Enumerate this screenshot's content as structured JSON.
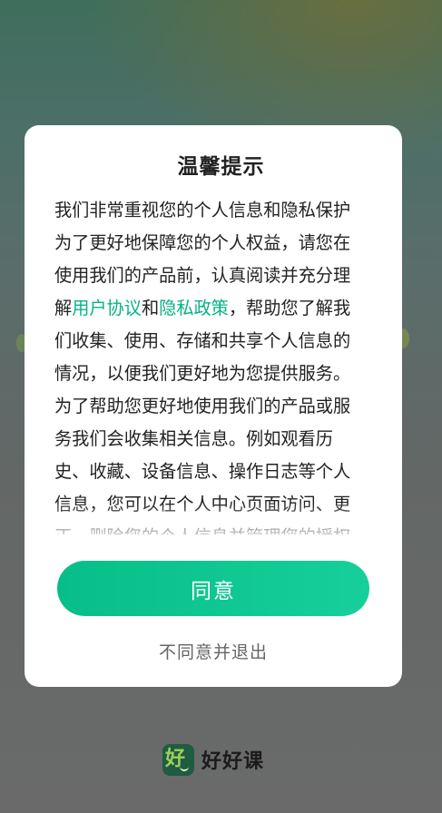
{
  "dialog": {
    "title": "温馨提示",
    "body_before": "我们非常重视您的个人信息和隐私保护为了更好地保障您的个人权益，请您在使用我们的产品前，认真阅读并充分理解",
    "link_user_agreement": "用户协议",
    "conjunction": "和",
    "link_privacy_policy": "隐私政策",
    "body_after": "，帮助您了解我们收集、使用、存储和共享个人信息的情况，以便我们更好地为您提供服务。",
    "body_paragraph2": "为了帮助您更好地使用我们的产品或服务我们会收集相关信息。例如观看历史、收藏、设备信息、操作日志等个人信息，您可以在个人中心页面访问、更正、删除您的个人信息并管理您的授权",
    "agree_label": "同意",
    "disagree_label": "不同意并退出"
  },
  "brand": {
    "logo_glyph": "好",
    "name": "好好课"
  },
  "colors": {
    "accent": "#08be88",
    "link": "#08b187"
  },
  "icons": {
    "brand_logo": "app-logo-icon"
  }
}
